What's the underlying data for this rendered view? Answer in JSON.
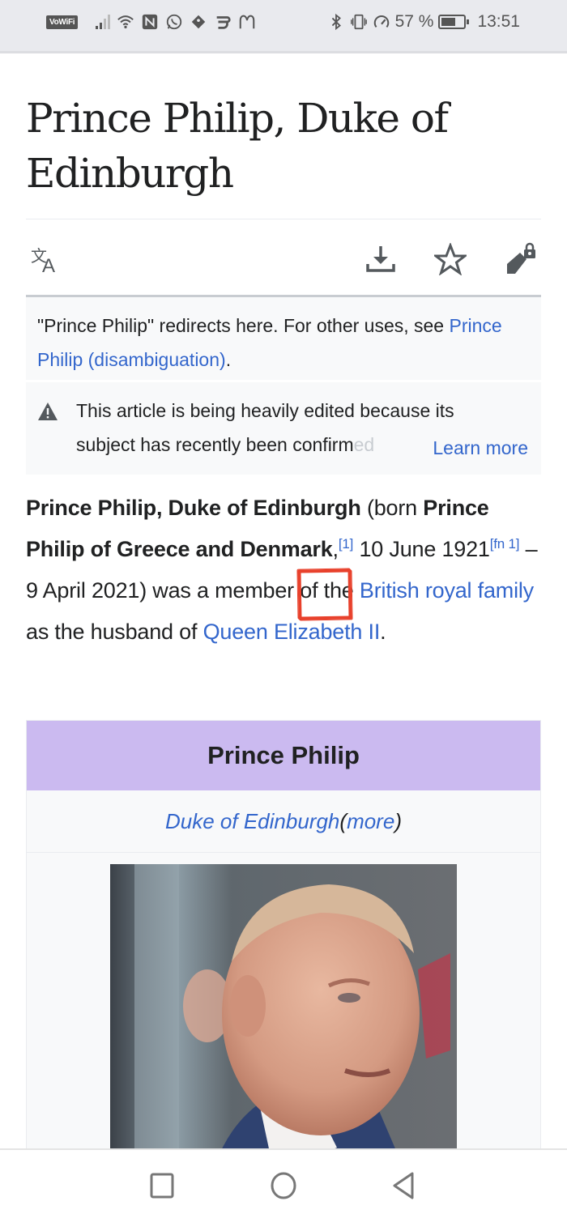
{
  "status_bar": {
    "vowifi_label": "VoWiFi",
    "left_icons": [
      "signal-icon",
      "wifi-icon",
      "nfc-icon",
      "whatsapp-icon",
      "app-icon",
      "app-icon-2",
      "mcdonalds-icon"
    ],
    "right_icons": [
      "bluetooth-icon",
      "vibrate-icon",
      "speed-icon"
    ],
    "battery_percent": "57 %",
    "battery_level": 0.57,
    "time": "13:51"
  },
  "page": {
    "title": "Prince Philip, Duke of Edinburgh",
    "actions": {
      "language_icon": "translate-icon",
      "download_icon": "download-icon",
      "watch_icon": "star-icon",
      "edit_icon": "edit-locked-icon"
    },
    "hatnote": {
      "text": "\"Prince Philip\" redirects here. For other uses, see ",
      "link": "Prince Philip (disambiguation)",
      "after": "."
    },
    "notice": {
      "icon": "warning-icon",
      "text_line1": "This article is being heavily edited because its",
      "text_line2": "subject has recently been confirm",
      "text_fade": "ed",
      "learn_more": "Learn more"
    },
    "lead": {
      "bold_name": "Prince Philip, Duke of Edinburgh",
      "born_prefix": " (born ",
      "bold_birthname": "Prince Philip of Greece and Denmark",
      "comma": ",",
      "ref1": "[1]",
      "dates_a": " 10 June 1921",
      "ref_fn1": "[fn 1]",
      "dates_b": " – 9 April 2021)",
      "was": " was",
      "member_text": " a member of the ",
      "link_family": "British royal family",
      "husband_text": " as the husband of ",
      "link_queen": "Queen Elizabeth II",
      "end": "."
    },
    "annotation": {
      "color": "#e8412c",
      "target_word": "was"
    },
    "infobox": {
      "header": "Prince Philip",
      "header_color": "#cbbaf0",
      "subtitle_link": "Duke of Edinburgh",
      "subtitle_open": " (",
      "subtitle_more": "more",
      "subtitle_close": ")",
      "photo_alt": "Photo of Prince Philip"
    }
  },
  "nav_bar": {
    "recents": "recents-square-icon",
    "home": "home-circle-icon",
    "back": "back-triangle-icon"
  },
  "colors": {
    "link": "#3366cc",
    "text": "#202122",
    "status_bar_bg": "#e9eaee"
  }
}
